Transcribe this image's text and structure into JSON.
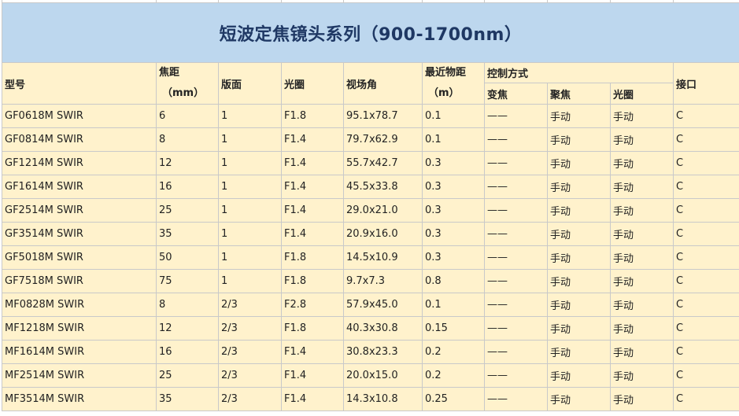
{
  "sheet": {
    "title": "短波定焦镜头系列（900-1700nm）",
    "headers": {
      "model": "型号",
      "focal_line1": "焦距",
      "focal_line2": "（mm）",
      "format": "版面",
      "aperture": "光圈",
      "fov": "视场角",
      "mod_line1": "最近物距",
      "mod_line2": "（m）",
      "control_group": "控制方式",
      "zoom": "变焦",
      "focus": "聚焦",
      "iris": "光圈",
      "mount": "接口"
    },
    "rows": [
      [
        "GF0618M SWIR",
        "6",
        "1",
        "F1.8",
        "95.1x78.7",
        "0.1",
        "——",
        "手动",
        "手动",
        "C"
      ],
      [
        "GF0814M SWIR",
        "8",
        "1",
        "F1.4",
        "79.7x62.9",
        "0.1",
        "——",
        "手动",
        "手动",
        "C"
      ],
      [
        "GF1214M SWIR",
        "12",
        "1",
        "F1.4",
        "55.7x42.7",
        "0.3",
        "——",
        "手动",
        "手动",
        "C"
      ],
      [
        "GF1614M SWIR",
        "16",
        "1",
        "F1.4",
        "45.5x33.8",
        "0.3",
        "——",
        "手动",
        "手动",
        "C"
      ],
      [
        "GF2514M SWIR",
        "25",
        "1",
        "F1.4",
        "29.0x21.0",
        "0.3",
        "——",
        "手动",
        "手动",
        "C"
      ],
      [
        "GF3514M SWIR",
        "35",
        "1",
        "F1.4",
        "20.9x16.0",
        "0.3",
        "——",
        "手动",
        "手动",
        "C"
      ],
      [
        "GF5018M SWIR",
        "50",
        "1",
        "F1.8",
        "14.5x10.9",
        "0.3",
        "——",
        "手动",
        "手动",
        "C"
      ],
      [
        "GF7518M SWIR",
        "75",
        "1",
        "F1.8",
        "9.7x7.3",
        "0.8",
        "——",
        "手动",
        "手动",
        "C"
      ],
      [
        "MF0828M SWIR",
        "8",
        "2/3",
        "F2.8",
        "57.9x45.0",
        "0.1",
        "——",
        "手动",
        "手动",
        "C"
      ],
      [
        "MF1218M SWIR",
        "12",
        "2/3",
        "F1.8",
        "40.3x30.8",
        "0.15",
        "——",
        "手动",
        "手动",
        "C"
      ],
      [
        "MF1614M SWIR",
        "16",
        "2/3",
        "F1.4",
        "30.8x23.3",
        "0.2",
        "——",
        "手动",
        "手动",
        "C"
      ],
      [
        "MF2514M SWIR",
        "25",
        "2/3",
        "F1.4",
        "20.0x15.0",
        "0.2",
        "——",
        "手动",
        "手动",
        "C"
      ],
      [
        "MF3514M SWIR",
        "35",
        "2/3",
        "F1.4",
        "14.3x10.8",
        "0.25",
        "——",
        "手动",
        "手动",
        "C"
      ]
    ],
    "colors": {
      "title_bg": "#bdd7ee",
      "title_text": "#1f3864",
      "cell_bg": "#fff2cc",
      "grid_line": "#c9c9c9"
    }
  }
}
